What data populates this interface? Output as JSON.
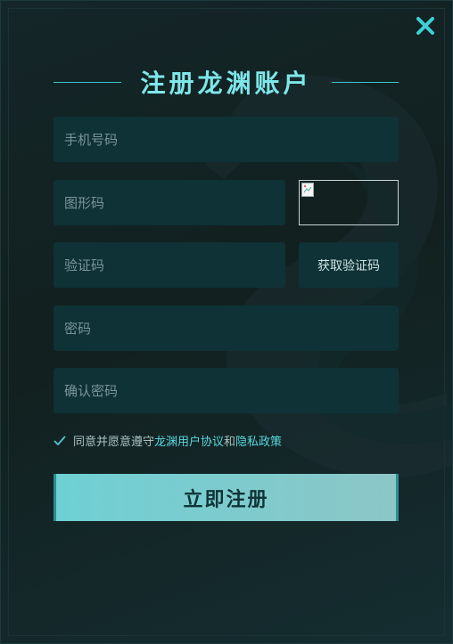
{
  "dialog": {
    "title": "注册龙渊账户",
    "close_icon": "close-icon"
  },
  "form": {
    "phone_placeholder": "手机号码",
    "captcha_placeholder": "图形码",
    "captcha_image_alt": "captcha-image",
    "sms_code_placeholder": "验证码",
    "get_code_label": "获取验证码",
    "password_placeholder": "密码",
    "confirm_password_placeholder": "确认密码"
  },
  "agreement": {
    "prefix": "同意并愿意遵守",
    "user_agreement": "龙渊用户协议",
    "and": "和",
    "privacy_policy": "隐私政策",
    "checked": true
  },
  "submit_label": "立即注册",
  "colors": {
    "accent": "#7ee7ea",
    "link": "#58d8de",
    "field_bg": "#0e3236",
    "button_bg": "#6ed0d4"
  }
}
